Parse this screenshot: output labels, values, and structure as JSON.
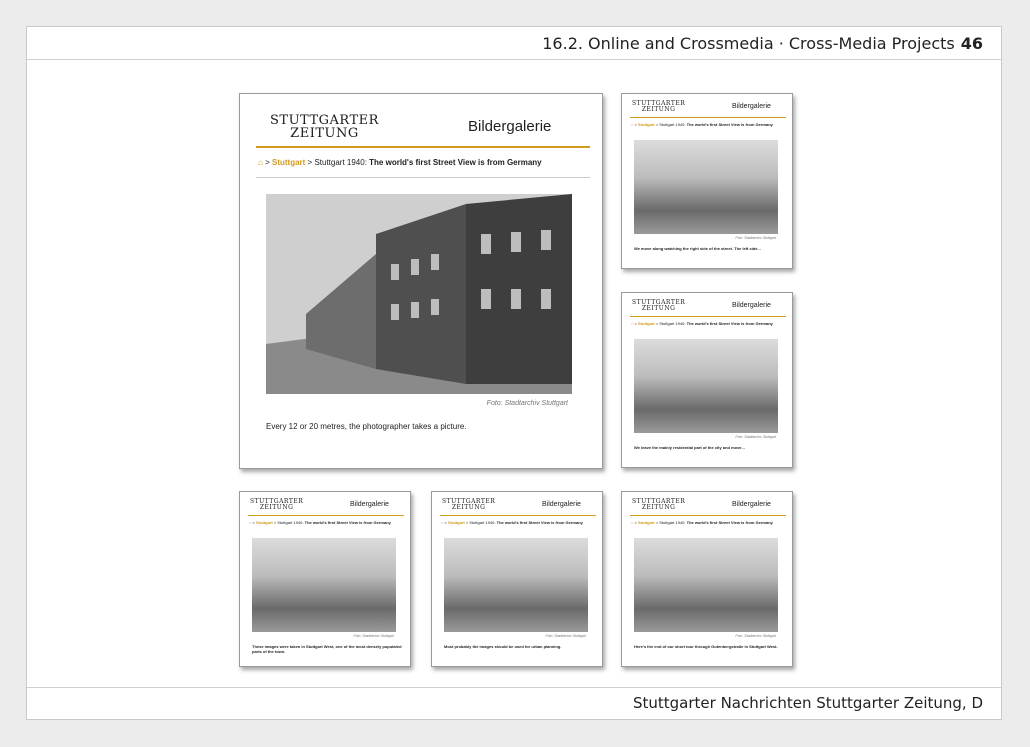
{
  "header": {
    "section": "16.2. Online and Crossmedia · Cross-Media Projects",
    "page": "46"
  },
  "footer": {
    "source": "Stuttgarter Nachrichten Stuttgarter Zeitung, D"
  },
  "gallery": {
    "logo_line1": "STUTTGARTER",
    "logo_line2": "ZEITUNG",
    "title": "Bildergalerie",
    "crumb_sep": ">",
    "crumb_section": "Stuttgart",
    "crumb_sep2": "> Stuttgart 1940:",
    "crumb_title": "The world's first Street View is from Germany",
    "credit": "Foto: Stadtarchiv Stuttgart"
  },
  "shots": [
    {
      "caption": "Every 12 or 20 metres, the photographer takes a picture."
    },
    {
      "caption": "We move along watching the right side of the street. The left side..."
    },
    {
      "caption": "We leave the mainly residential part of the city and move..."
    },
    {
      "caption": "These images were taken in Stuttgart West, one of the most densely populated parts of the town."
    },
    {
      "caption": "Most probably the images should be used for urban planning."
    },
    {
      "caption": "Here's the end of our short tour through Gutenbergstraße in Stuttgart West."
    }
  ],
  "icons": {
    "home": "home-icon"
  },
  "colors": {
    "accent": "#d19a1c",
    "frame_border": "#c9c9c9",
    "background": "#ececec"
  }
}
